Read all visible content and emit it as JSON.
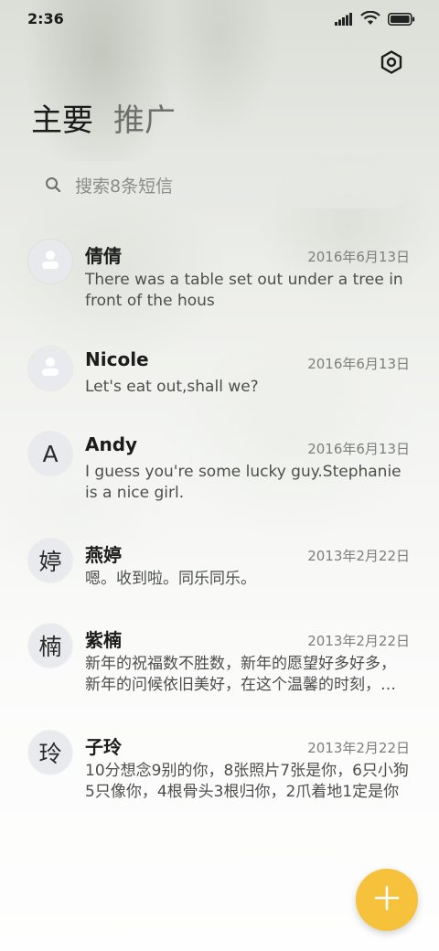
{
  "status_bar": {
    "time": "2:36"
  },
  "tabs": [
    {
      "label": "主要",
      "active": true
    },
    {
      "label": "推广",
      "active": false
    }
  ],
  "search": {
    "placeholder": "搜索8条短信"
  },
  "conversations": [
    {
      "name": "倩倩",
      "date": "2016年6月13日",
      "preview": "There was a table set out under a tree in front of the hous",
      "avatar": "person-icon"
    },
    {
      "name": "Nicole",
      "date": "2016年6月13日",
      "preview": "Let's eat out,shall we?",
      "avatar": "person-icon"
    },
    {
      "name": "Andy",
      "date": "2016年6月13日",
      "preview": "I guess you're some lucky guy.Stephanie is a nice girl.",
      "avatar_letter": "A"
    },
    {
      "name": "燕婷",
      "date": "2013年2月22日",
      "preview": "嗯。收到啦。同乐同乐。",
      "avatar_letter": "婷"
    },
    {
      "name": "紫楠",
      "date": "2013年2月22日",
      "preview": "新年的祝福数不胜数，新年的愿望好多好多，新年的问候依旧美好，在这个温馨的时刻，送上我最真挚的祝福",
      "avatar_letter": "楠"
    },
    {
      "name": "子玲",
      "date": "2013年2月22日",
      "preview": "10分想念9别的你，8张照片7张是你，6只小狗5只像你，4根骨头3根归你，2爪着地1定是你",
      "avatar_letter": "玲"
    }
  ],
  "icons": {
    "settings": "settings-icon",
    "search": "search-icon",
    "fab": "plus-icon"
  },
  "colors": {
    "fab": "#f6c13b"
  }
}
